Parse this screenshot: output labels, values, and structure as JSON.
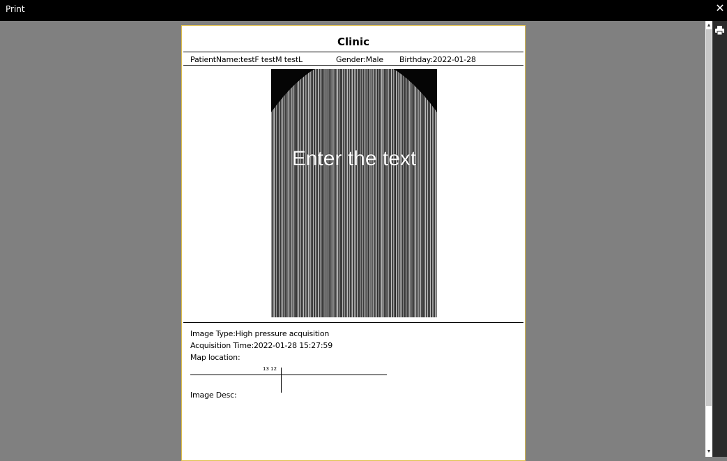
{
  "window": {
    "title": "Print",
    "close_glyph": "✕"
  },
  "toolbar": {
    "print_icon": "printer-icon"
  },
  "scrollbar": {
    "up_glyph": "▲",
    "down_glyph": "▼"
  },
  "report": {
    "title": "Clinic",
    "patient_name": "PatientName:testF testM testL",
    "gender": "Gender:Male",
    "birthday": "Birthday:2022-01-28",
    "image_overlay_text": "Enter the text",
    "image_type": "Image Type:High pressure acquisition",
    "acquisition_time": "Acquisition Time:2022-01-28 15:27:59",
    "map_location_label": "Map location:",
    "map_marker": "13 12",
    "image_desc_label": "Image Desc:"
  },
  "colors": {
    "page_border": "#e0bf4a",
    "background": "#808080",
    "titlebar": "#000000"
  }
}
